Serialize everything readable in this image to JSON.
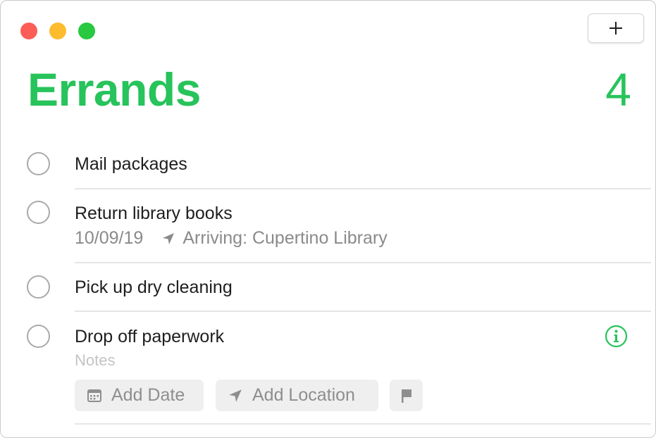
{
  "window": {
    "controls": [
      "close",
      "minimize",
      "zoom"
    ],
    "add_button_icon": "plus-icon"
  },
  "list": {
    "title": "Errands",
    "count": "4",
    "accent_color": "#27c35b"
  },
  "tasks": [
    {
      "title": "Mail packages",
      "completed": false
    },
    {
      "title": "Return library books",
      "date": "10/09/19",
      "location": "Arriving: Cupertino Library",
      "location_icon": "location-arrow-icon",
      "completed": false
    },
    {
      "title": "Pick up dry cleaning",
      "completed": false
    },
    {
      "title": "Drop off paperwork",
      "notes_placeholder": "Notes",
      "completed": false,
      "selected": true,
      "info_icon": "info-icon"
    }
  ],
  "editor": {
    "add_date_label": "Add Date",
    "add_date_icon": "calendar-icon",
    "add_location_label": "Add Location",
    "add_location_icon": "location-arrow-icon",
    "flag_icon": "flag-icon"
  }
}
